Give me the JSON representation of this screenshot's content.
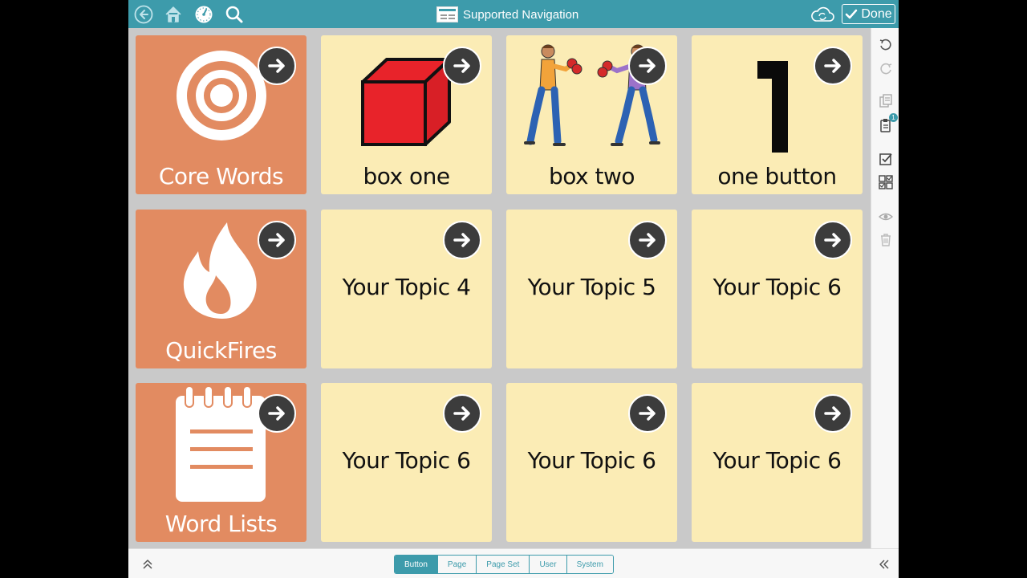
{
  "window": {
    "title": "Supported Navigation"
  },
  "topbar": {
    "icons": [
      "back-icon",
      "home-icon",
      "dashboard-icon",
      "search-icon",
      "cloud-sync-icon"
    ],
    "done_label": "Done",
    "accent": "#3d9bab"
  },
  "grid": {
    "cells": [
      {
        "label": "Core Words",
        "style": "orange",
        "icon": "target-icon"
      },
      {
        "label": "box one",
        "style": "yellow",
        "icon": "red-cube-icon"
      },
      {
        "label": "box two",
        "style": "yellow",
        "icon": "boxers-icon"
      },
      {
        "label": "one button",
        "style": "yellow",
        "icon": "number-one-icon"
      },
      {
        "label": "QuickFires",
        "style": "orange",
        "icon": "flame-icon"
      },
      {
        "label": "Your Topic 4",
        "style": "yellow"
      },
      {
        "label": "Your Topic 5",
        "style": "yellow"
      },
      {
        "label": "Your Topic 6",
        "style": "yellow"
      },
      {
        "label": "Word Lists",
        "style": "orange",
        "icon": "notepad-icon"
      },
      {
        "label": "Your Topic 6",
        "style": "yellow"
      },
      {
        "label": "Your Topic 6",
        "style": "yellow"
      },
      {
        "label": "Your Topic 6",
        "style": "yellow"
      }
    ],
    "colors": {
      "orange": "#e28b61",
      "yellow": "#fbecb5"
    }
  },
  "rightbar": {
    "icons": [
      "undo-icon",
      "redo-icon",
      "copy-icon",
      "paste-icon",
      "select-icon",
      "multi-select-icon",
      "visibility-icon",
      "trash-icon"
    ],
    "paste_badge": "1"
  },
  "bottombar": {
    "tabs": [
      "Button",
      "Page",
      "Page Set",
      "User",
      "System"
    ],
    "active_tab": "Button"
  }
}
